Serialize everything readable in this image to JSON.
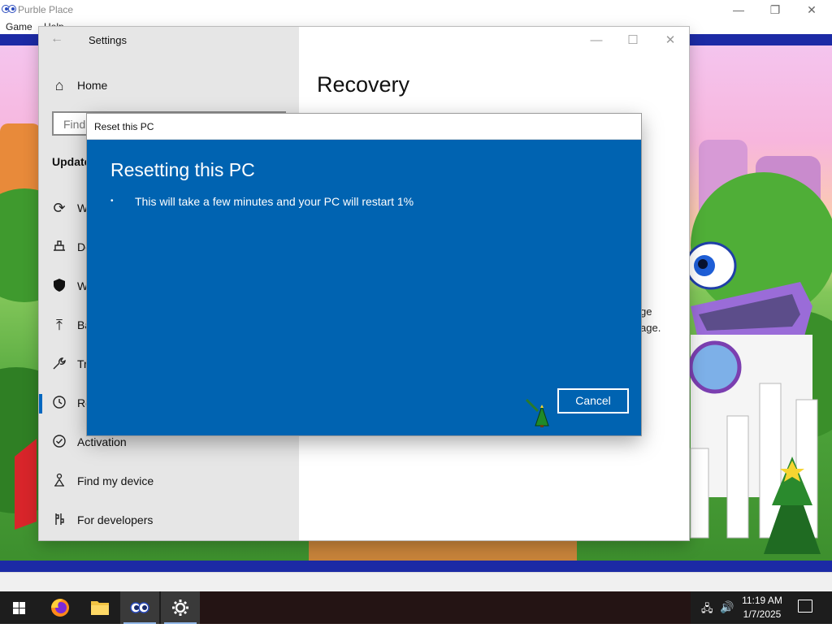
{
  "purble_place": {
    "title": "Purble Place",
    "menu": [
      "Game",
      "Help"
    ],
    "controls": {
      "minimize": "—",
      "restore": "❐",
      "close": "✕"
    }
  },
  "settings": {
    "title": "Settings",
    "back_icon": "back-arrow-icon",
    "heading": "Recovery",
    "search_placeholder": "Find",
    "section_heading": "Update",
    "nav": [
      {
        "label": "Home",
        "icon": "home-icon"
      },
      {
        "label": "W",
        "icon": "sync-icon"
      },
      {
        "label": "De",
        "icon": "delivery-icon"
      },
      {
        "label": "W",
        "icon": "shield-icon"
      },
      {
        "label": "Ba",
        "icon": "backup-icon"
      },
      {
        "label": "Tr",
        "icon": "wrench-icon"
      },
      {
        "label": "Re",
        "icon": "history-icon"
      },
      {
        "label": "Activation",
        "icon": "check-circle-icon"
      },
      {
        "label": "Find my device",
        "icon": "person-icon"
      },
      {
        "label": "For developers",
        "icon": "developer-icon"
      }
    ],
    "right_text_1": "ge",
    "right_text_2": "age.",
    "controls": {
      "minimize": "—",
      "maximize": "☐",
      "close": "✕"
    }
  },
  "reset_dialog": {
    "title": "Reset this PC",
    "heading": "Resetting this PC",
    "bullet": "•",
    "message": "This will take a few minutes and your PC will restart 1%",
    "progress_percent": 1,
    "cancel_label": "Cancel"
  },
  "taskbar": {
    "apps": [
      "windows-start-icon",
      "firefox-icon",
      "file-explorer-icon",
      "purble-place-icon",
      "settings-gear-icon"
    ],
    "time": "11:19 AM",
    "date": "1/7/2025"
  },
  "colors": {
    "dialog_blue": "#0063b1",
    "accent": "#0067c0",
    "taskbar": "#1d1d1d"
  }
}
